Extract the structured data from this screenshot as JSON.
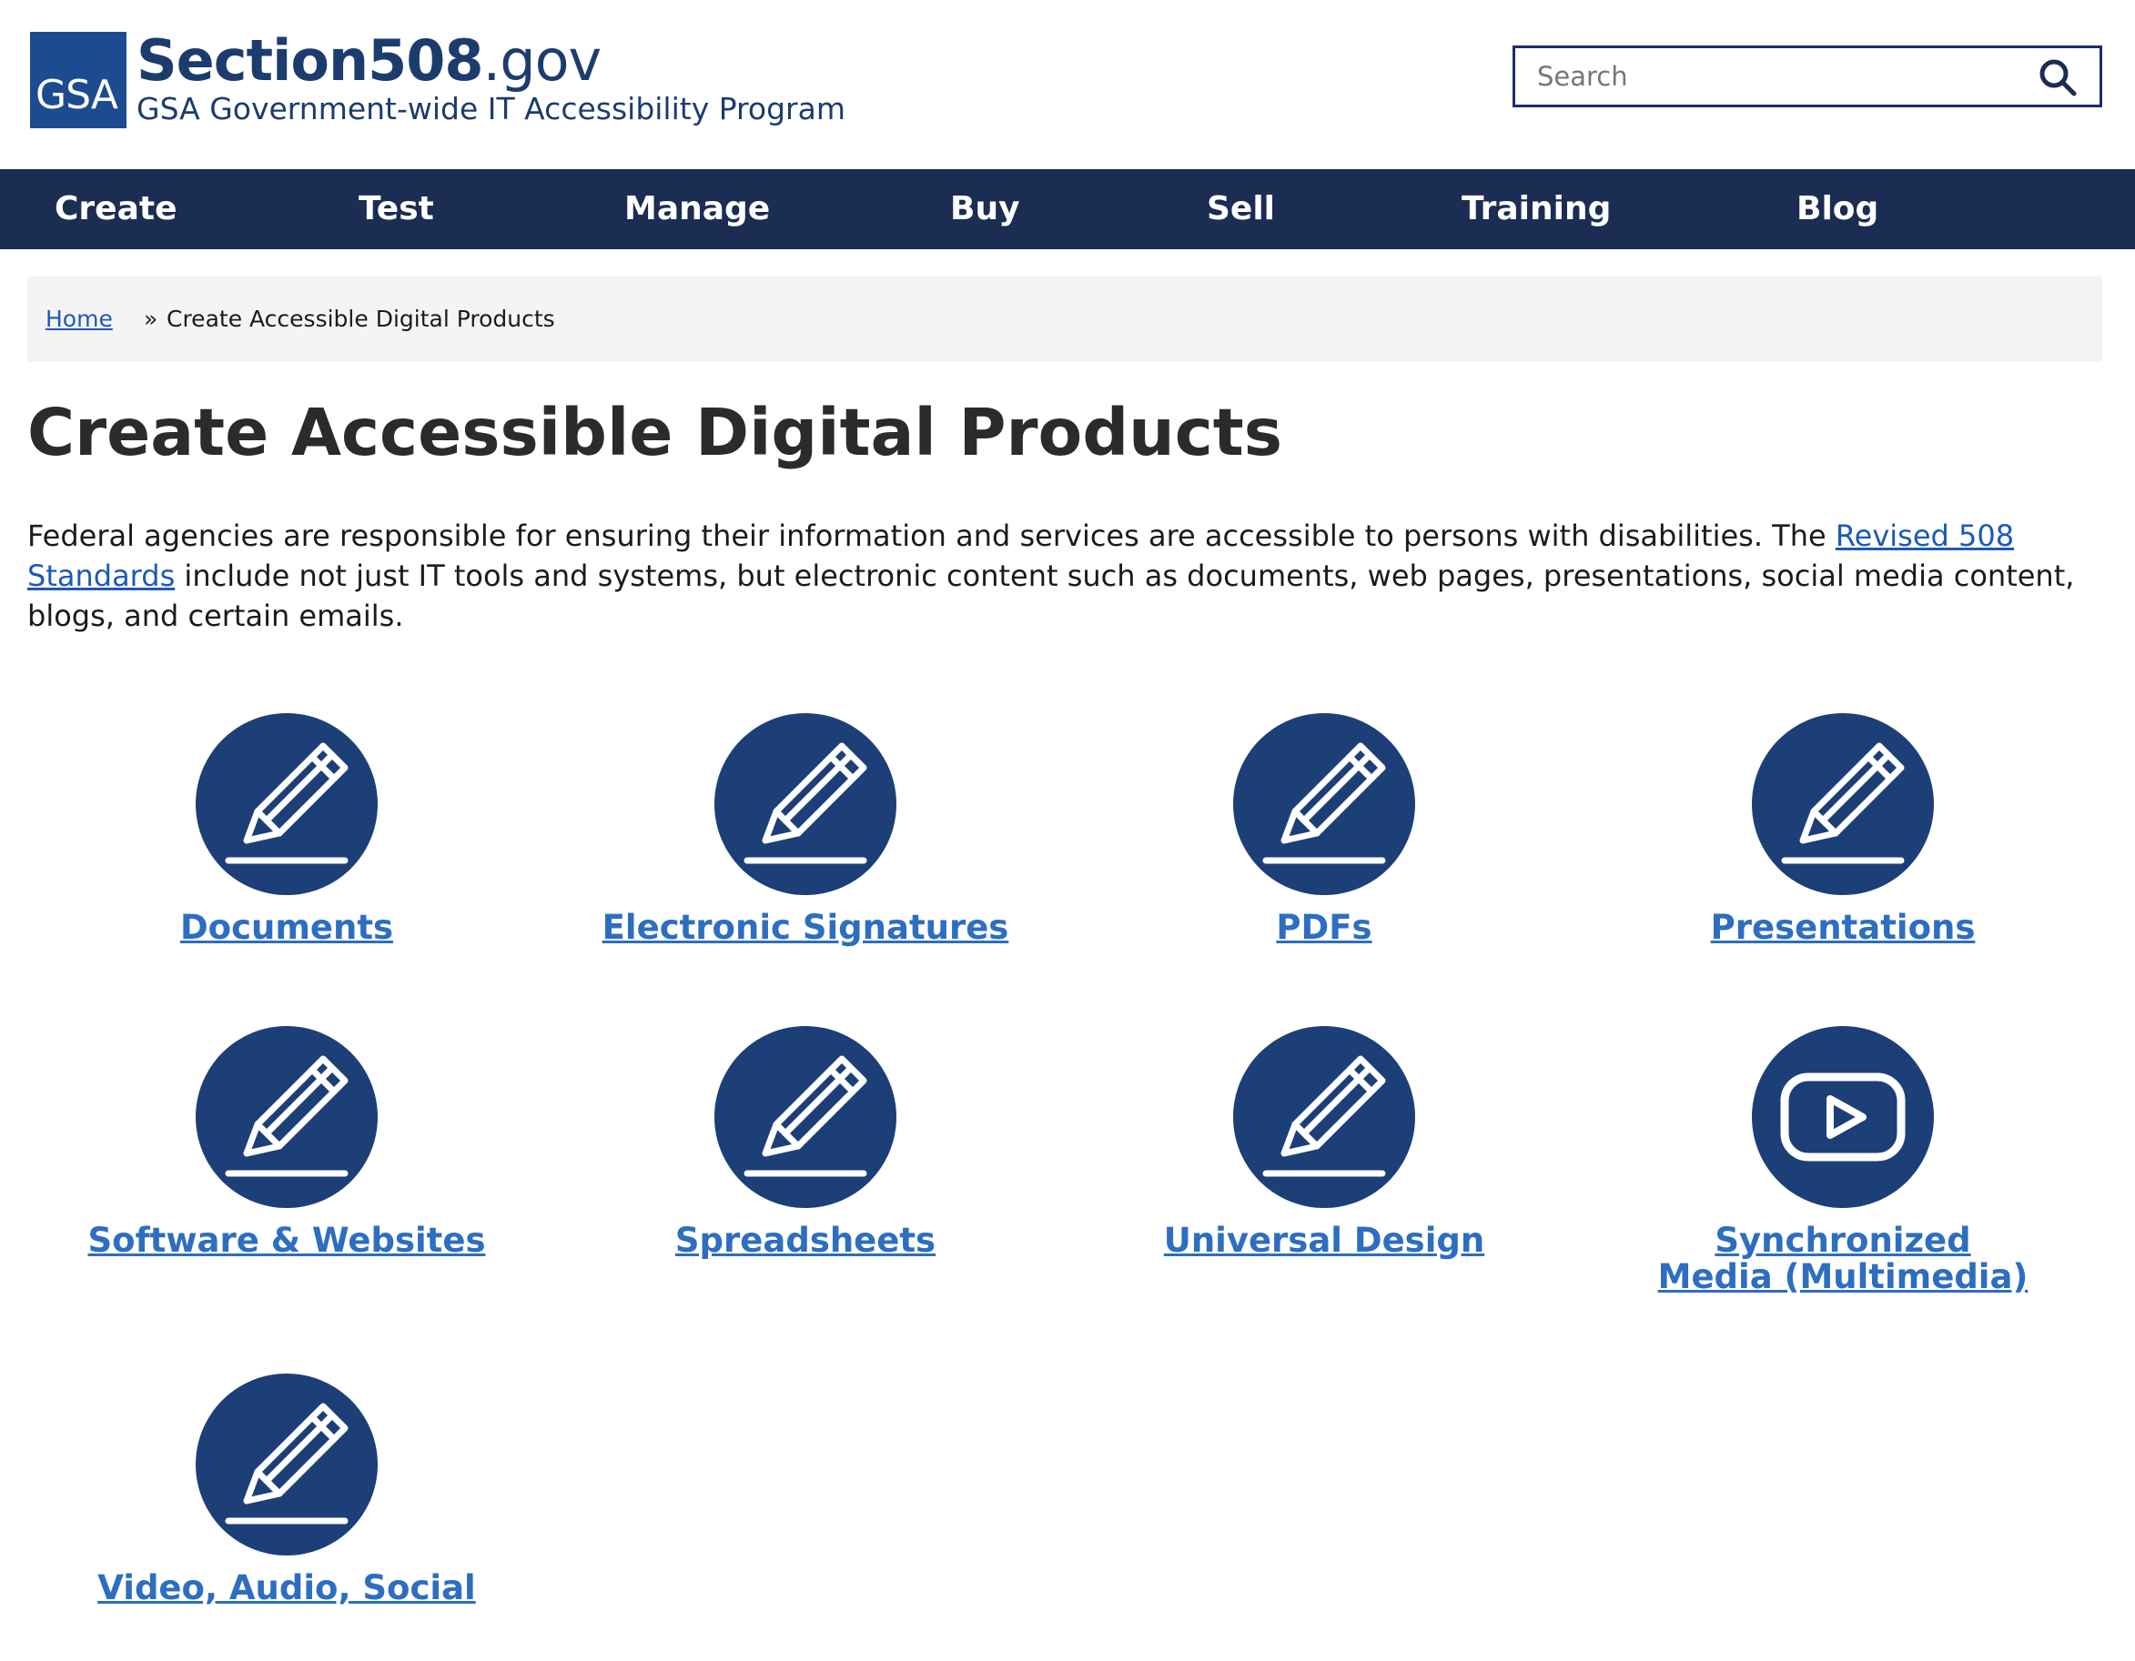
{
  "site": {
    "logo_text": "GSA",
    "title_main": "Section508",
    "title_suffix": ".gov",
    "subtitle": "GSA Government-wide IT Accessibility Program"
  },
  "search": {
    "placeholder": "Search",
    "icon": "magnifier-icon"
  },
  "nav": {
    "items": [
      "Create",
      "Test",
      "Manage",
      "Buy",
      "Sell",
      "Training",
      "Blog"
    ]
  },
  "breadcrumb": {
    "home": "Home",
    "separator": "»",
    "current": "Create Accessible Digital Products"
  },
  "page": {
    "title": "Create Accessible Digital Products",
    "intro_before": "Federal agencies are responsible for ensuring their information and services are accessible to persons with disabilities. The ",
    "intro_link": "Revised 508 Standards",
    "intro_after": " include not just IT tools and systems, but electronic content such as documents, web pages, presentations, social media content, blogs, and certain emails."
  },
  "cards": [
    {
      "label": "Documents",
      "icon": "pencil-icon"
    },
    {
      "label": "Electronic Signatures",
      "icon": "pencil-icon"
    },
    {
      "label": "PDFs",
      "icon": "pencil-icon"
    },
    {
      "label": "Presentations",
      "icon": "pencil-icon"
    },
    {
      "label": "Software & Websites",
      "icon": "pencil-icon"
    },
    {
      "label": "Spreadsheets",
      "icon": "pencil-icon"
    },
    {
      "label": "Universal Design",
      "icon": "pencil-icon"
    },
    {
      "label": "Synchronized Media (Multimedia)",
      "icon": "video-play-icon"
    },
    {
      "label": "Video, Audio, Social",
      "icon": "pencil-icon"
    }
  ],
  "colors": {
    "nav_bg": "#1b2d52",
    "icon_circle": "#1d3f77",
    "link": "#2d6ec0",
    "brand": "#1d3c6e"
  }
}
